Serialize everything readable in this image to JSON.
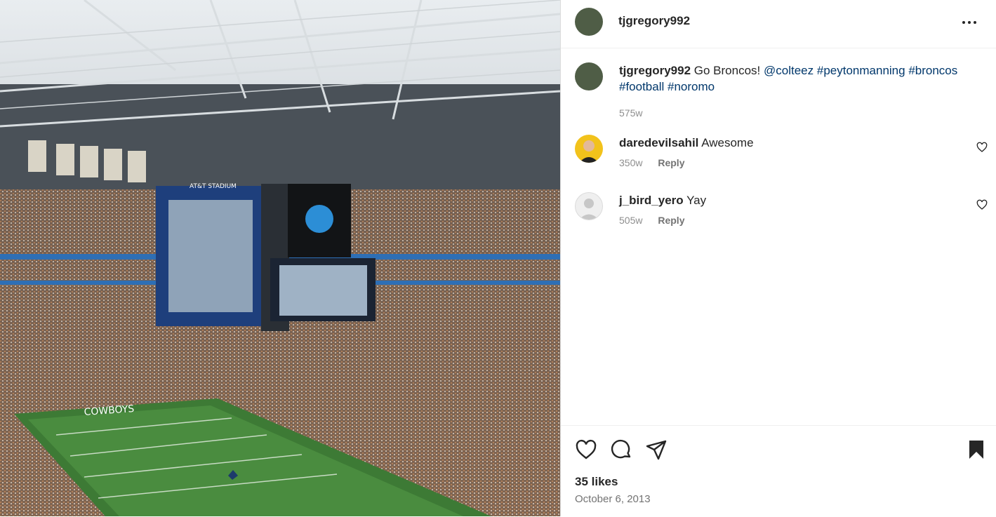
{
  "post": {
    "username": "tjgregory992",
    "caption_user": "tjgregory992",
    "caption_text": "Go Broncos!",
    "tags": [
      "@colteez",
      "#peytonmanning",
      "#broncos",
      "#football",
      "#noromo"
    ],
    "caption_time": "575w",
    "likes": "35 likes",
    "date": "October 6, 2013",
    "photo_board_text": "AT&T STADIUM",
    "photo_field_text": "COWBOYS"
  },
  "comments": [
    {
      "user": "daredevilsahil",
      "text": "Awesome",
      "time": "350w",
      "reply": "Reply"
    },
    {
      "user": "j_bird_yero",
      "text": "Yay",
      "time": "505w",
      "reply": "Reply"
    }
  ],
  "icons": [
    "more-icon",
    "heart-icon",
    "comment-icon",
    "share-icon",
    "bookmark-icon"
  ],
  "colors": {
    "link": "#00376b",
    "muted": "#8e8e8e",
    "text": "#262626"
  }
}
